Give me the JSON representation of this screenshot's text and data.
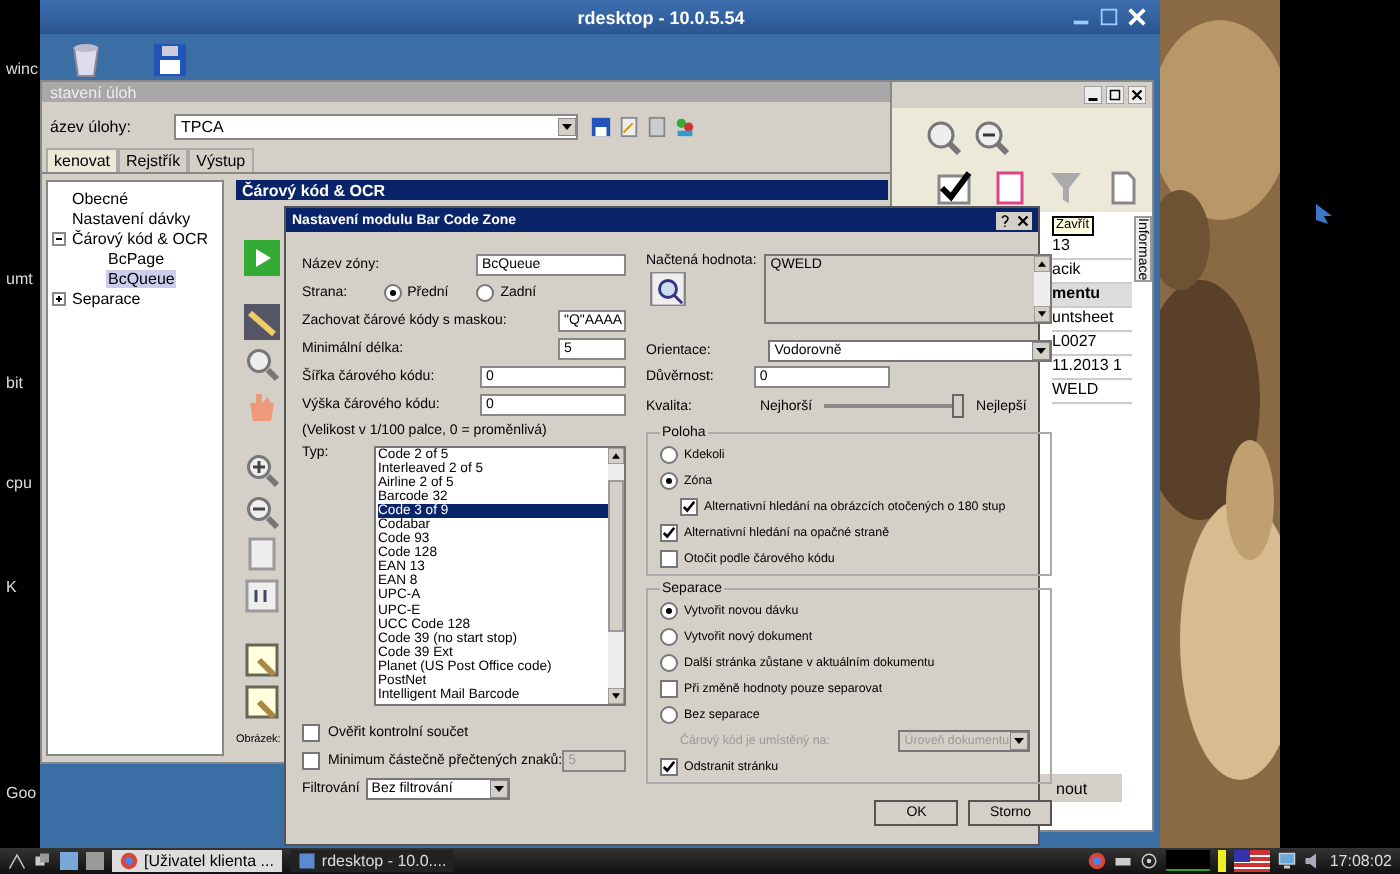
{
  "desktop": {
    "icon_labels": [
      "winc",
      "umt",
      "bit",
      "cpu",
      "K",
      "Goo"
    ]
  },
  "rdesktop": {
    "title": "rdesktop - 10.0.5.54"
  },
  "task_window": {
    "title": "stavení úloh",
    "name_label": "ázev úlohy:",
    "name_value": "TPCA",
    "tabs": [
      {
        "label": "kenovat",
        "selected": true
      },
      {
        "label": "Rejstřík",
        "selected": false
      },
      {
        "label": "Výstup",
        "selected": false
      }
    ],
    "tree": [
      {
        "label": "Obecné",
        "selected": false
      },
      {
        "label": "Nastavení dávky",
        "selected": false
      },
      {
        "label": "Čárový kód & OCR",
        "selected": false,
        "expanded": true,
        "children": [
          {
            "label": "BcPage",
            "selected": false
          },
          {
            "label": "BcQueue",
            "selected": true
          }
        ]
      },
      {
        "label": "Separace",
        "selected": false,
        "expanded": false
      }
    ],
    "panel_title": "Čárový kód & OCR",
    "image_label": "Obrázek:"
  },
  "back_window": {
    "tooltip": "Zavřít",
    "side_tab": "Informace",
    "footer": "nout",
    "cells": [
      {
        "text": "13",
        "kind": "cell"
      },
      {
        "text": "acik",
        "kind": "cell"
      },
      {
        "text": "mentu",
        "kind": "header"
      },
      {
        "text": "untsheet",
        "kind": "cell"
      },
      {
        "text": "L0027",
        "kind": "cell"
      },
      {
        "text": "11.2013 1",
        "kind": "cell"
      },
      {
        "text": "WELD",
        "kind": "cell"
      }
    ]
  },
  "dialog": {
    "title": "Nastavení modulu Bar Code Zone",
    "zone_name": {
      "label": "Název zóny:",
      "value": "BcQueue"
    },
    "side": {
      "label": "Strana:",
      "options": [
        {
          "label": "Přední",
          "selected": true
        },
        {
          "label": "Zadní",
          "selected": false
        }
      ]
    },
    "fields": [
      {
        "label": "Zachovat čárové kódy s maskou:",
        "value": "\"Q\"AAAA",
        "kind": "short"
      },
      {
        "label": "Minimální délka:",
        "value": "5",
        "kind": "short"
      },
      {
        "label": "Šířka čárového kódu:",
        "value": "0",
        "kind": "long"
      },
      {
        "label": "Výška čárového kódu:",
        "value": "0",
        "kind": "long"
      }
    ],
    "size_note": "(Velikost v 1/100 palce, 0 = proměnlivá)",
    "type_label": "Typ:",
    "types": [
      {
        "label": "Code 2 of 5",
        "selected": false
      },
      {
        "label": "Interleaved 2 of 5",
        "selected": false
      },
      {
        "label": "Airline 2 of 5",
        "selected": false
      },
      {
        "label": "Barcode 32",
        "selected": false
      },
      {
        "label": "Code 3 of 9",
        "selected": true
      },
      {
        "label": "Codabar",
        "selected": false
      },
      {
        "label": "Code 93",
        "selected": false
      },
      {
        "label": "Code 128",
        "selected": false
      },
      {
        "label": "EAN 13",
        "selected": false
      },
      {
        "label": "EAN 8",
        "selected": false
      },
      {
        "label": "UPC-A",
        "selected": false
      },
      {
        "label": "UPC-E",
        "selected": false
      },
      {
        "label": "UCC Code 128",
        "selected": false
      },
      {
        "label": "Code 39 (no start stop)",
        "selected": false
      },
      {
        "label": "Code 39 Ext",
        "selected": false
      },
      {
        "label": "Planet (US Post Office code)",
        "selected": false
      },
      {
        "label": "PostNet",
        "selected": false
      },
      {
        "label": "Intelligent Mail Barcode",
        "selected": false
      }
    ],
    "verify": {
      "label": "Ověřit kontrolní součet",
      "checked": false
    },
    "minimum": {
      "label": "Minimum částečně přečtených znaků:",
      "checked": false,
      "value": "5",
      "disabled": true
    },
    "filter": {
      "label": "Filtrování",
      "value": "Bez filtrování"
    },
    "read_value": {
      "label": "Načtená hodnota:",
      "value": "QWELD"
    },
    "orientation": {
      "label": "Orientace:",
      "value": "Vodorovně"
    },
    "confidence": {
      "label": "Důvěrnost:",
      "value": "0"
    },
    "quality": {
      "label": "Kvalita:",
      "min_label": "Nejhorší",
      "max_label": "Nejlepší",
      "level": 1
    },
    "groups": [
      {
        "title": "Poloha",
        "items": [
          {
            "kind": "radio",
            "label": "Kdekoli",
            "selected": false
          },
          {
            "kind": "radio",
            "label": "Zóna",
            "selected": true
          },
          {
            "kind": "subcheck",
            "label": "Alternativní hledání na obrázcích otočených o 180 stup",
            "checked": true
          },
          {
            "kind": "check",
            "label": "Alternativní hledání na opačné straně",
            "checked": true
          },
          {
            "kind": "check",
            "label": "Otočit podle čárového kódu",
            "checked": false
          }
        ]
      },
      {
        "title": "Separace",
        "items": [
          {
            "kind": "radio",
            "label": "Vytvořit novou dávku",
            "selected": true
          },
          {
            "kind": "radio",
            "label": "Vytvořit nový dokument",
            "selected": false
          },
          {
            "kind": "radio",
            "label": "Další stránka zůstane v aktuálním dokumentu",
            "selected": false
          },
          {
            "kind": "check",
            "label": "Při změně hodnoty pouze separovat",
            "checked": false
          },
          {
            "kind": "radio",
            "label": "Bez separace",
            "selected": false
          },
          {
            "kind": "select",
            "label": "Čárový kód je umístěný na:",
            "value": "Úroveň dokumentu",
            "disabled": true
          },
          {
            "kind": "check",
            "label": "Odstranit stránku",
            "checked": true
          }
        ]
      }
    ],
    "buttons": [
      "OK",
      "Storno"
    ]
  },
  "taskbar": {
    "tasks": [
      "[Uživatel klienta ...",
      "rdesktop - 10.0...."
    ],
    "clock": "17:08:02"
  }
}
